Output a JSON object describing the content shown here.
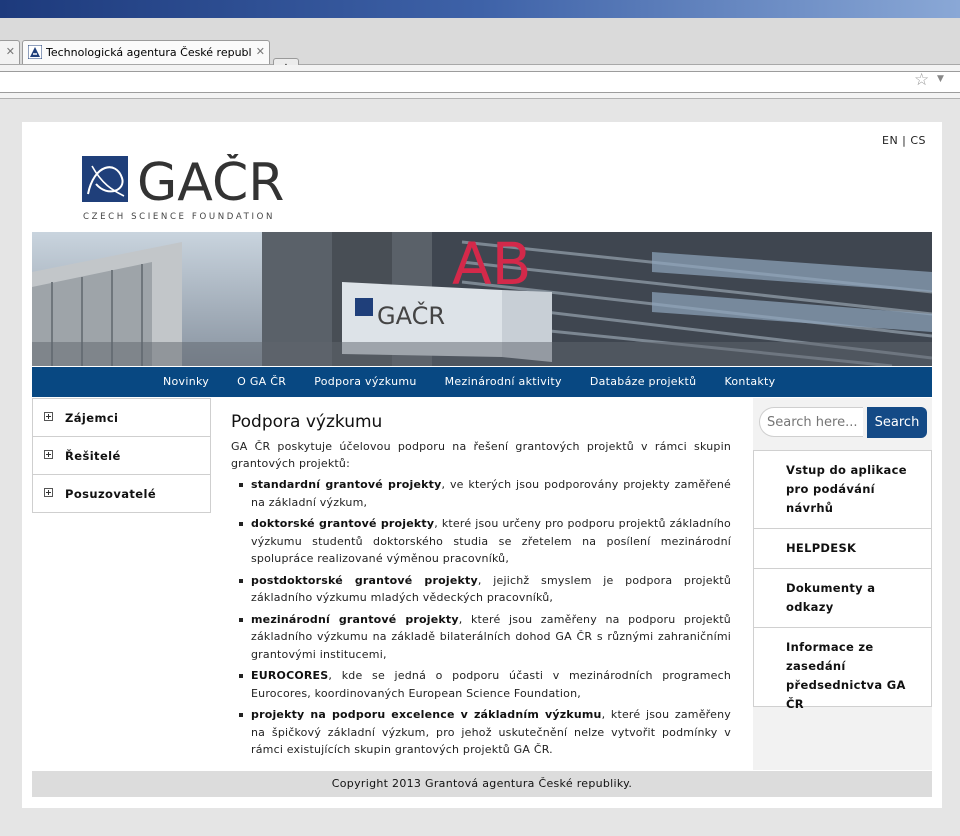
{
  "browser": {
    "tab_title": "Technologická agentura České republiky ...",
    "new_tab_label": "+"
  },
  "page": {
    "lang": "EN | CS",
    "logo": {
      "wordmark": "GAČR",
      "tagline": "CZECH SCIENCE FOUNDATION"
    },
    "banner": {
      "sign_text": "GAČR",
      "building_letters": "AB"
    },
    "nav": [
      "Novinky",
      "O GA ČR",
      "Podpora výzkumu",
      "Mezinárodní aktivity",
      "Databáze projektů",
      "Kontakty"
    ],
    "sidebar_left": [
      "Zájemci",
      "Řešitelé",
      "Posuzovatelé"
    ],
    "content": {
      "heading": "Podpora výzkumu",
      "intro": "GA ČR poskytuje účelovou podporu na řešení grantových projektů v rámci skupin grantových projektů:",
      "items": [
        {
          "bold": "standardní grantové projekty",
          "rest": ", ve kterých jsou podporovány projekty zaměřené na základní výzkum,"
        },
        {
          "bold": "doktorské grantové projekty",
          "rest": ", které jsou určeny pro podporu projektů základního výzkumu studentů doktorského studia se zřetelem na posílení mezinárodní spolupráce realizované výměnou pracovníků,"
        },
        {
          "bold": "postdoktorské grantové projekty",
          "rest": ", jejichž smyslem je podpora projektů základního výzkumu mladých vědeckých pracovníků,"
        },
        {
          "bold": "mezinárodní grantové projekty",
          "rest": ", které jsou zaměřeny na podporu projektů základního výzkumu na základě bilaterálních dohod GA ČR s různými zahraničními grantovými institucemi,"
        },
        {
          "bold": "EUROCORES",
          "rest": ", kde se jedná o podporu účasti v mezinárodních programech Eurocores, koordinovaných European Science Foundation,"
        },
        {
          "bold": "projekty na podporu excelence v základním výzkumu",
          "rest": ", které jsou zaměřeny na špičkový základní výzkum, pro jehož uskutečnění nelze vytvořit podmínky v rámci existujících skupin grantových projektů GA ČR."
        }
      ]
    },
    "sidebar_right": {
      "search_placeholder": "Search here...",
      "search_button": "Search",
      "links": [
        "Vstup do aplikace pro podávání návrhů",
        "HELPDESK",
        "Dokumenty a odkazy",
        "Informace ze zasedání předsednictva GA ČR"
      ]
    },
    "footer": "Copyright 2013 Grantová agentura České republiky."
  },
  "colors": {
    "nav_bg": "#084882",
    "search_button": "#144a86",
    "logo_blue": "#1f3f7a"
  }
}
